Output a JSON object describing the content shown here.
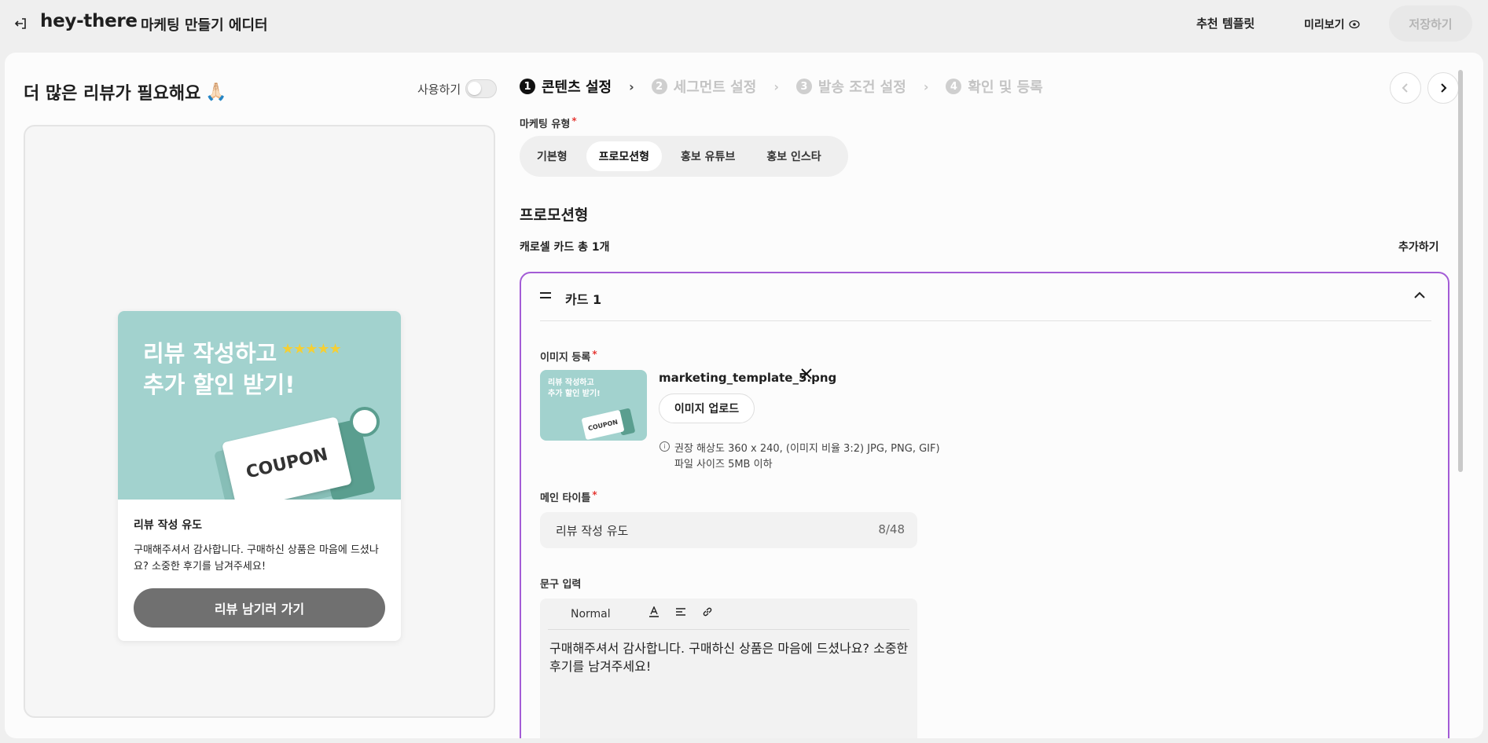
{
  "header": {
    "brand": "hey-there",
    "editor_title": "마케팅 만들기 에디터",
    "template_link": "추천 템플릿",
    "preview_link": "미리보기",
    "save_button": "저장하기"
  },
  "left": {
    "title": "더 많은 리뷰가 필요해요",
    "title_emoji": "🙏🏻",
    "toggle_label": "사용하기",
    "toggle_on": false,
    "card_preview": {
      "image_headline_1": "리뷰 작성하고",
      "image_headline_2": "추가 할인 받기!",
      "image_stars": "★★★★★",
      "image_coupon": "COUPON",
      "title": "리뷰 작성 유도",
      "description": "구매해주셔서 감사합니다. 구매하신 상품은 마음에 드셨나요? 소중한 후기를 남겨주세요!",
      "cta": "리뷰 남기러 가기"
    }
  },
  "steps": [
    {
      "num": "1",
      "label": "콘텐츠 설정",
      "active": true
    },
    {
      "num": "2",
      "label": "세그먼트 설정",
      "active": false
    },
    {
      "num": "3",
      "label": "발송 조건 설정",
      "active": false
    },
    {
      "num": "4",
      "label": "확인 및 등록",
      "active": false
    }
  ],
  "form": {
    "marketing_type_label": "마케팅 유형",
    "marketing_types": [
      "기본형",
      "프로모션형",
      "홍보 유튜브",
      "홍보 인스타"
    ],
    "selected_type": "프로모션형",
    "section_title": "프로모션형",
    "carousel_count": "캐로셀 카드 총 1개",
    "add_label": "추가하기",
    "card": {
      "title": "카드 1",
      "image_label": "이미지 등록",
      "thumb_text_1": "리뷰 작성하고",
      "thumb_text_2": "추가 할인 받기!",
      "thumb_coupon": "COUPON",
      "file_name": "marketing_template_5.png",
      "upload_button": "이미지 업로드",
      "hint_1": "권장 해상도 360 x 240, (이미지 비율 3:2) JPG, PNG, GIF)",
      "hint_2": "파일 사이즈 5MB 이하",
      "main_title_label": "메인 타이틀",
      "main_title_value": "리뷰 작성 유도",
      "main_title_count": "8/48",
      "body_label": "문구 입력",
      "editor_format": "Normal",
      "body_text": "구매해주셔서 감사합니다. 구매하신 상품은 마음에 드셨나요? 소중한 후기를 남겨주세요!"
    }
  },
  "colors": {
    "accent_border": "#a35cd6",
    "image_bg": "#a2d2ce",
    "coupon_green": "#5a9e8f",
    "stars": "#f4cf35"
  }
}
